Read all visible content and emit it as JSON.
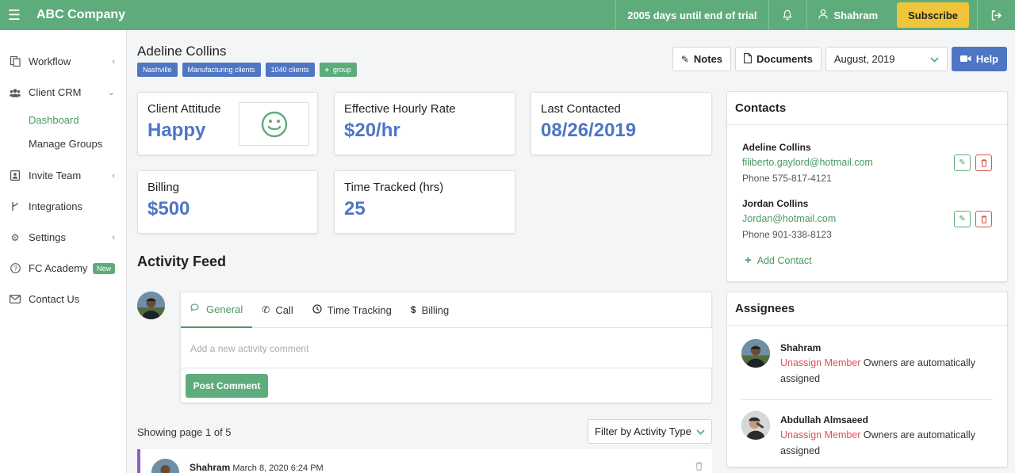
{
  "topbar": {
    "brand": "ABC Company",
    "trial_text": "2005 days until end of trial",
    "user_name": "Shahram",
    "subscribe_label": "Subscribe"
  },
  "sidebar": {
    "items": [
      {
        "label": "Workflow",
        "icon": "workflow-icon"
      },
      {
        "label": "Client CRM",
        "icon": "users-icon"
      },
      {
        "label": "Dashboard"
      },
      {
        "label": "Manage Groups"
      },
      {
        "label": "Invite Team",
        "icon": "contact-card-icon"
      },
      {
        "label": "Integrations",
        "icon": "fork-icon"
      },
      {
        "label": "Settings",
        "icon": "gear-icon"
      },
      {
        "label": "FC Academy",
        "icon": "question-circle-icon",
        "badge": "New"
      },
      {
        "label": "Contact Us",
        "icon": "envelope-icon"
      }
    ]
  },
  "client": {
    "name": "Adeline Collins",
    "tags": [
      "Nashville",
      "Manufacturing clients",
      "1040 clients"
    ],
    "group_tag": "group"
  },
  "toolbar": {
    "notes_label": "Notes",
    "documents_label": "Documents",
    "month_value": "August, 2019",
    "help_label": "Help"
  },
  "stats": {
    "attitude_label": "Client Attitude",
    "attitude_value": "Happy",
    "rate_label": "Effective Hourly Rate",
    "rate_value": "$20/hr",
    "contacted_label": "Last Contacted",
    "contacted_value": "08/26/2019",
    "billing_label": "Billing",
    "billing_value": "$500",
    "time_label": "Time Tracked (hrs)",
    "time_value": "25"
  },
  "feed": {
    "title": "Activity Feed",
    "tabs": [
      "General",
      "Call",
      "Time Tracking",
      "Billing"
    ],
    "comment_placeholder": "Add a new activity comment",
    "post_label": "Post Comment",
    "page_info": "Showing page 1 of 5",
    "filter_label": "Filter by Activity Type",
    "entry_name": "Shahram",
    "entry_date": "March 8, 2020 6:24 PM"
  },
  "contacts": {
    "title": "Contacts",
    "list": [
      {
        "name": "Adeline Collins",
        "email": "filiberto.gaylord@hotmail.com",
        "phone": "Phone 575-817-4121"
      },
      {
        "name": "Jordan Collins",
        "email": "Jordan@hotmail.com",
        "phone": "Phone 901-338-8123"
      }
    ],
    "add_label": "Add Contact"
  },
  "assignees": {
    "title": "Assignees",
    "unassign_label": "Unassign Member",
    "note": " Owners are automatically assigned",
    "list": [
      {
        "name": "Shahram"
      },
      {
        "name": "Abdullah Almsaeed"
      }
    ]
  },
  "colors": {
    "brand_green": "#5eac7b",
    "link_blue": "#4f76c4",
    "subscribe_yellow": "#f0c53c",
    "danger_red": "#d9534f",
    "entry_purple": "#8e5fc4"
  }
}
